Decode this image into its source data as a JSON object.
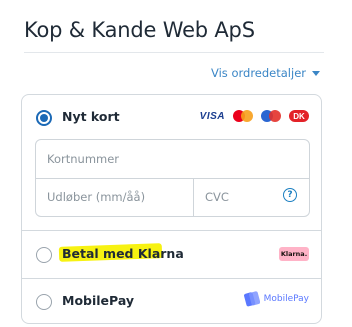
{
  "merchant": {
    "name": "Kop & Kande Web ApS"
  },
  "order_link": {
    "label": "Vis ordredetaljer"
  },
  "payment_options": {
    "card": {
      "label": "Nyt kort",
      "selected": true,
      "brands": [
        "VISA",
        "Mastercard",
        "Maestro",
        "Dankort"
      ],
      "visa_text": "VISA",
      "dankort_text": "DK",
      "fields": {
        "card_number_placeholder": "Kortnummer",
        "expiry_placeholder": "Udløber (mm/åå)",
        "cvc_placeholder": "CVC",
        "help_glyph": "?"
      }
    },
    "klarna": {
      "label": "Betal med Klarna",
      "badge": "Klarna.",
      "highlight_color": "#f7f212"
    },
    "mobilepay": {
      "label": "MobilePay",
      "logo_text": "MobilePay"
    }
  },
  "colors": {
    "accent": "#1b69b6",
    "link": "#3b86c6",
    "border": "#d3d9de",
    "klarna_pink": "#ffb3c7",
    "mobilepay_blue": "#5a78ff"
  }
}
